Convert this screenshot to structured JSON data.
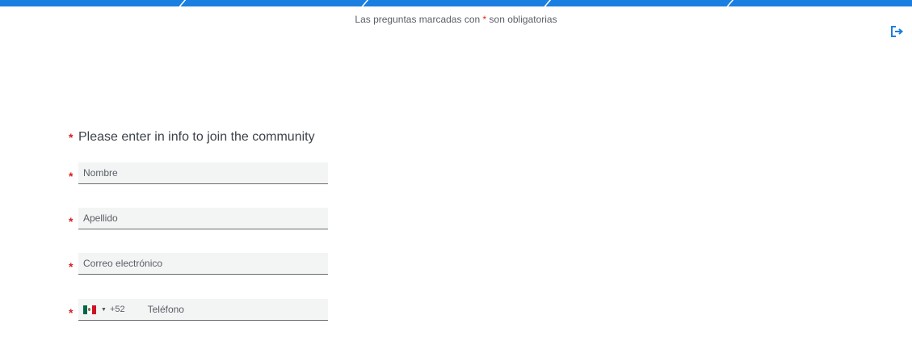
{
  "header": {
    "required_note_prefix": "Las preguntas marcadas con",
    "required_star": "*",
    "required_note_suffix": "son obligatorias",
    "exit_icon": "exit-icon"
  },
  "question": {
    "required_star": "*",
    "title": "Please enter in info to join the community"
  },
  "fields": {
    "first_name_placeholder": "Nombre",
    "last_name_placeholder": "Apellido",
    "email_placeholder": "Correo electrónico",
    "phone_placeholder": "Teléfono",
    "country_dial_code": "+52",
    "country_flag": "mexico-flag-icon"
  },
  "colors": {
    "accent": "#1a7fe0",
    "required": "#d61f1f"
  }
}
